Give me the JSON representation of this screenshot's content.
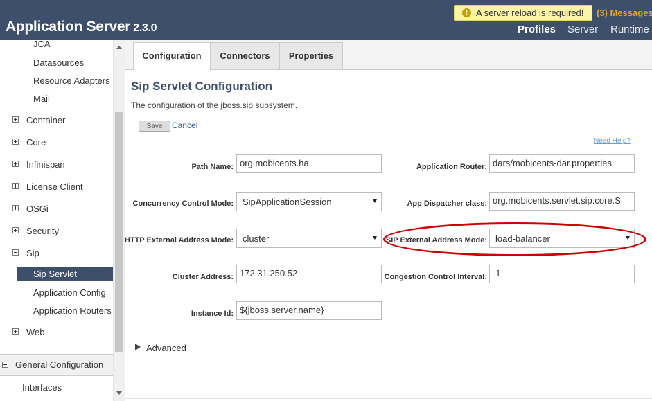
{
  "header": {
    "app_title": "Application Server",
    "version": "2.3.0",
    "reload_banner": "A server reload is required!",
    "messages": "(3) Messages",
    "nav": [
      "Profiles",
      "Server",
      "Runtime"
    ]
  },
  "sidebar": {
    "items": {
      "jca": "JCA",
      "datasources": "Datasources",
      "resource_adapters": "Resource Adapters",
      "mail": "Mail",
      "container": "Container",
      "core": "Core",
      "infinispan": "Infinispan",
      "license_client": "License Client",
      "osgi": "OSGi",
      "security": "Security",
      "sip": "Sip",
      "sip_servlet": "Sip Servlet",
      "application_config": "Application Config",
      "application_routers": "Application Routers",
      "web": "Web",
      "general_configuration": "General Configuration",
      "interfaces": "Interfaces"
    }
  },
  "tabs": [
    "Configuration",
    "Connectors",
    "Properties"
  ],
  "page": {
    "title": "Sip Servlet Configuration",
    "subtitle": "The configuration of the jboss.sip subsystem.",
    "save": "Save",
    "cancel": "Cancel",
    "need_help": "Need Help?"
  },
  "form": {
    "path_name": {
      "label": "Path Name:",
      "value": "org.mobicents.ha"
    },
    "concurrency_control_mode": {
      "label": "Concurrency Control Mode:",
      "value": "SipApplicationSession"
    },
    "http_external_address_mode": {
      "label": "HTTP External Address Mode:",
      "value": "cluster"
    },
    "cluster_address": {
      "label": "Cluster Address:",
      "value": "172.31.250.52"
    },
    "instance_id": {
      "label": "Instance Id:",
      "value": "${jboss.server.name}"
    },
    "application_router": {
      "label": "Application Router:",
      "value": "dars/mobicents-dar.properties"
    },
    "app_dispatcher_class": {
      "label": "App Dispatcher class:",
      "value": "org.mobicents.servlet.sip.core.S"
    },
    "sip_external_address_mode": {
      "label": "SIP External Address Mode:",
      "value": "load-balancer"
    },
    "congestion_control_interval": {
      "label": "Congestion Control Interval:",
      "value": "-1"
    }
  },
  "advanced": "Advanced",
  "colors": {
    "header_bg": "#3d4f6b",
    "banner_bg": "#fbf3a5",
    "messages": "#e8a820",
    "highlight": "#cc0000"
  }
}
